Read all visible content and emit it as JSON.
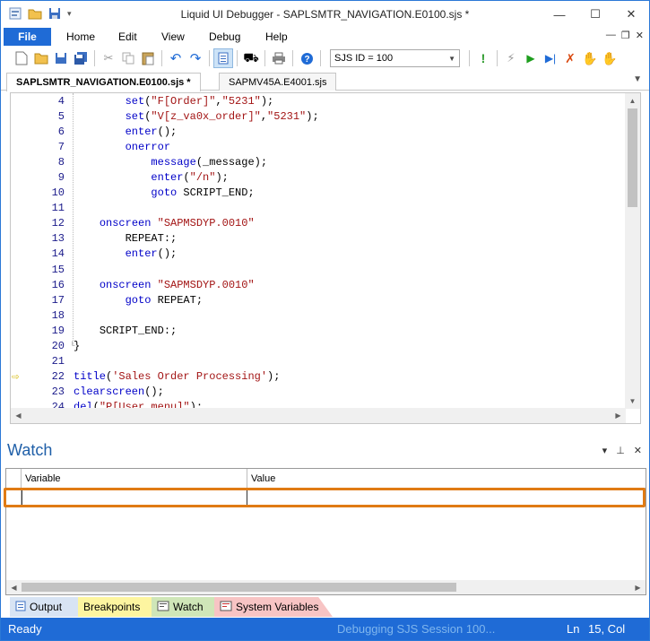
{
  "window": {
    "title": "Liquid UI Debugger - SAPLSMTR_NAVIGATION.E0100.sjs *",
    "minimize": "—",
    "maximize": "☐",
    "close": "✕"
  },
  "menu": {
    "file": "File",
    "items": [
      "Home",
      "Edit",
      "View",
      "Debug",
      "Help"
    ]
  },
  "toolbar": {
    "sjs_select": "SJS ID = 100"
  },
  "doc_tabs": [
    {
      "label": "SAPLSMTR_NAVIGATION.E0100.sjs *",
      "active": true
    },
    {
      "label": "SAPMV45A.E4001.sjs",
      "active": false
    }
  ],
  "editor": {
    "current_line": "22",
    "lines": [
      {
        "n": "4",
        "indent": "        ",
        "tokens": [
          [
            "kw",
            "set"
          ],
          [
            "plain",
            "("
          ],
          [
            "str",
            "\"F[Order]\""
          ],
          [
            "plain",
            ","
          ],
          [
            "str",
            "\"5231\""
          ],
          [
            "plain",
            ");"
          ]
        ]
      },
      {
        "n": "5",
        "indent": "        ",
        "tokens": [
          [
            "kw",
            "set"
          ],
          [
            "plain",
            "("
          ],
          [
            "str",
            "\"V[z_va0x_order]\""
          ],
          [
            "plain",
            ","
          ],
          [
            "str",
            "\"5231\""
          ],
          [
            "plain",
            ");"
          ]
        ]
      },
      {
        "n": "6",
        "indent": "        ",
        "tokens": [
          [
            "kw",
            "enter"
          ],
          [
            "plain",
            "();"
          ]
        ]
      },
      {
        "n": "7",
        "indent": "        ",
        "tokens": [
          [
            "kw",
            "onerror"
          ]
        ]
      },
      {
        "n": "8",
        "indent": "            ",
        "tokens": [
          [
            "kw",
            "message"
          ],
          [
            "plain",
            "(_message);"
          ]
        ]
      },
      {
        "n": "9",
        "indent": "            ",
        "tokens": [
          [
            "kw",
            "enter"
          ],
          [
            "plain",
            "("
          ],
          [
            "str",
            "\"/n\""
          ],
          [
            "plain",
            ");"
          ]
        ]
      },
      {
        "n": "10",
        "indent": "            ",
        "tokens": [
          [
            "kw",
            "goto"
          ],
          [
            "plain",
            " SCRIPT_END;"
          ]
        ]
      },
      {
        "n": "11",
        "indent": "",
        "tokens": []
      },
      {
        "n": "12",
        "indent": "    ",
        "tokens": [
          [
            "kw",
            "onscreen"
          ],
          [
            "plain",
            " "
          ],
          [
            "str",
            "\"SAPMSDYP.0010\""
          ]
        ]
      },
      {
        "n": "13",
        "indent": "        ",
        "tokens": [
          [
            "plain",
            "REPEAT:;"
          ]
        ]
      },
      {
        "n": "14",
        "indent": "        ",
        "tokens": [
          [
            "kw",
            "enter"
          ],
          [
            "plain",
            "();"
          ]
        ]
      },
      {
        "n": "15",
        "indent": "",
        "tokens": []
      },
      {
        "n": "16",
        "indent": "    ",
        "tokens": [
          [
            "kw",
            "onscreen"
          ],
          [
            "plain",
            " "
          ],
          [
            "str",
            "\"SAPMSDYP.0010\""
          ]
        ]
      },
      {
        "n": "17",
        "indent": "        ",
        "tokens": [
          [
            "kw",
            "goto"
          ],
          [
            "plain",
            " REPEAT;"
          ]
        ]
      },
      {
        "n": "18",
        "indent": "",
        "tokens": []
      },
      {
        "n": "19",
        "indent": "    ",
        "tokens": [
          [
            "plain",
            "SCRIPT_END:;"
          ]
        ]
      },
      {
        "n": "20",
        "indent": "",
        "tokens": [
          [
            "plain",
            "}"
          ]
        ]
      },
      {
        "n": "21",
        "indent": "",
        "tokens": []
      },
      {
        "n": "22",
        "indent": "",
        "tokens": [
          [
            "kw",
            "title"
          ],
          [
            "plain",
            "("
          ],
          [
            "str",
            "'Sales Order Processing'"
          ],
          [
            "plain",
            ");"
          ]
        ]
      },
      {
        "n": "23",
        "indent": "",
        "tokens": [
          [
            "kw",
            "clearscreen"
          ],
          [
            "plain",
            "();"
          ]
        ]
      },
      {
        "n": "24",
        "indent": "",
        "tokens": [
          [
            "kw",
            "del"
          ],
          [
            "plain",
            "("
          ],
          [
            "str",
            "\"P[User menu]\""
          ],
          [
            "plain",
            ");"
          ]
        ]
      }
    ]
  },
  "watch": {
    "title": "Watch",
    "columns": [
      "Variable",
      "Value"
    ]
  },
  "bottom_tabs": [
    {
      "label": "Output",
      "icon": "output-icon",
      "color": "#d8e4f4"
    },
    {
      "label": "Breakpoints",
      "icon": "",
      "color": "#fdf5a0"
    },
    {
      "label": "Watch",
      "icon": "watch-icon",
      "color": "#cfe6b8"
    },
    {
      "label": "System Variables",
      "icon": "system-variables-icon",
      "color": "#f7c4c4"
    }
  ],
  "status": {
    "ready": "Ready",
    "session": "Debugging SJS Session 100...",
    "ln": "Ln",
    "col": "15, Col"
  },
  "colors": {
    "accent": "#1f6bd6",
    "highlight": "#e07b14",
    "keyword": "#0000c8",
    "string": "#a31515"
  }
}
